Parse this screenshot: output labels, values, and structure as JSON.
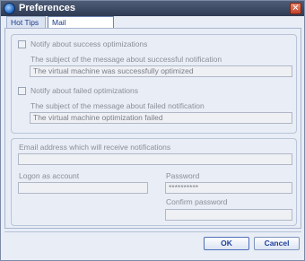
{
  "window": {
    "title": "Preferences",
    "close_glyph": "✕"
  },
  "tabs": [
    {
      "label": "Hot Tips"
    },
    {
      "label": "Mail Notifications"
    }
  ],
  "success": {
    "checkbox_label": "Notify about success optimizations",
    "subject_label": "The subject of the message about successful notification",
    "subject_value": "The virtual machine was successfully optimized",
    "checked": false
  },
  "failed": {
    "checkbox_label": "Notify about failed optimizations",
    "subject_label": "The subject of the message about failed notification",
    "subject_value": "The virtual machine optimization failed",
    "checked": false
  },
  "account": {
    "email_label": "Email address which will receive notifications",
    "email_value": "",
    "logon_label": "Logon as account",
    "logon_value": "",
    "password_label": "Password",
    "password_value": "**********",
    "confirm_label": "Confirm password",
    "confirm_value": ""
  },
  "buttons": {
    "ok": "OK",
    "cancel": "Cancel"
  },
  "icons": {
    "app": "app-logo-icon",
    "close": "close-icon"
  },
  "colors": {
    "title_bar": "#3a4763",
    "tab_text": "#1a3c8a",
    "button_text": "#1f3f9a"
  }
}
